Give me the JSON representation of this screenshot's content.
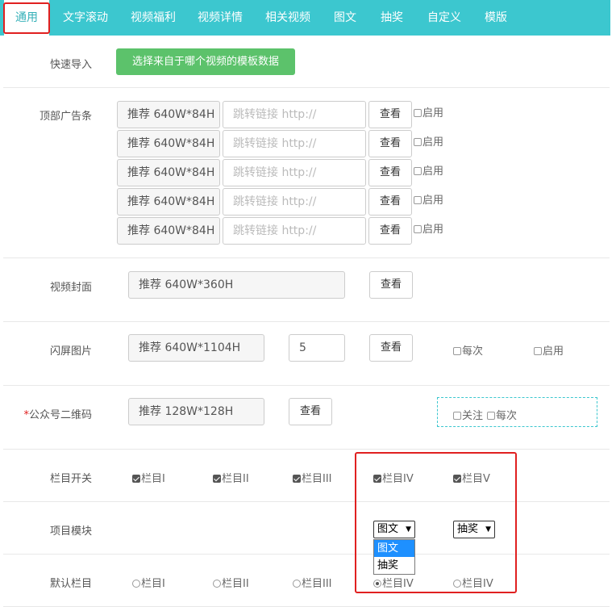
{
  "tabs": [
    "通用",
    "文字滚动",
    "视频福利",
    "视频详情",
    "相关视频",
    "图文",
    "抽奖",
    "自定义",
    "模版"
  ],
  "quick_import": {
    "label": "快速导入",
    "button": "选择来自于哪个视频的模板数据"
  },
  "top_ad": {
    "label": "顶部广告条",
    "rows": [
      {
        "size_hint": "推荐 640W*84H",
        "link_placeholder": "跳转链接 http://",
        "view": "查看",
        "enable": "启用"
      },
      {
        "size_hint": "推荐 640W*84H",
        "link_placeholder": "跳转链接 http://",
        "view": "查看",
        "enable": "启用"
      },
      {
        "size_hint": "推荐 640W*84H",
        "link_placeholder": "跳转链接 http://",
        "view": "查看",
        "enable": "启用"
      },
      {
        "size_hint": "推荐 640W*84H",
        "link_placeholder": "跳转链接 http://",
        "view": "查看",
        "enable": "启用"
      },
      {
        "size_hint": "推荐 640W*84H",
        "link_placeholder": "跳转链接 http://",
        "view": "查看",
        "enable": "启用"
      }
    ]
  },
  "cover": {
    "label": "视频封面",
    "hint": "推荐 640W*360H",
    "view": "查看"
  },
  "splash": {
    "label": "闪屏图片",
    "hint": "推荐 640W*1104H",
    "seconds": "5",
    "view": "查看",
    "every": "每次",
    "enable": "启用"
  },
  "qr": {
    "required_mark": "*",
    "label": "公众号二维码",
    "hint": "推荐 128W*128H",
    "view": "查看",
    "follow": "关注",
    "every": "每次"
  },
  "column_switch": {
    "label": "栏目开关",
    "items": [
      {
        "text": "栏目I",
        "checked": true
      },
      {
        "text": "栏目II",
        "checked": true
      },
      {
        "text": "栏目III",
        "checked": true
      },
      {
        "text": "栏目IV",
        "checked": true
      },
      {
        "text": "栏目V",
        "checked": true
      }
    ]
  },
  "module": {
    "label": "项目模块",
    "select_iv": "图文",
    "select_v": "抽奖",
    "options": [
      "图文",
      "抽奖"
    ]
  },
  "default_column": {
    "label": "默认栏目",
    "items": [
      "栏目I",
      "栏目II",
      "栏目III",
      "栏目IV",
      "栏目IV"
    ],
    "selected_index": 3
  }
}
